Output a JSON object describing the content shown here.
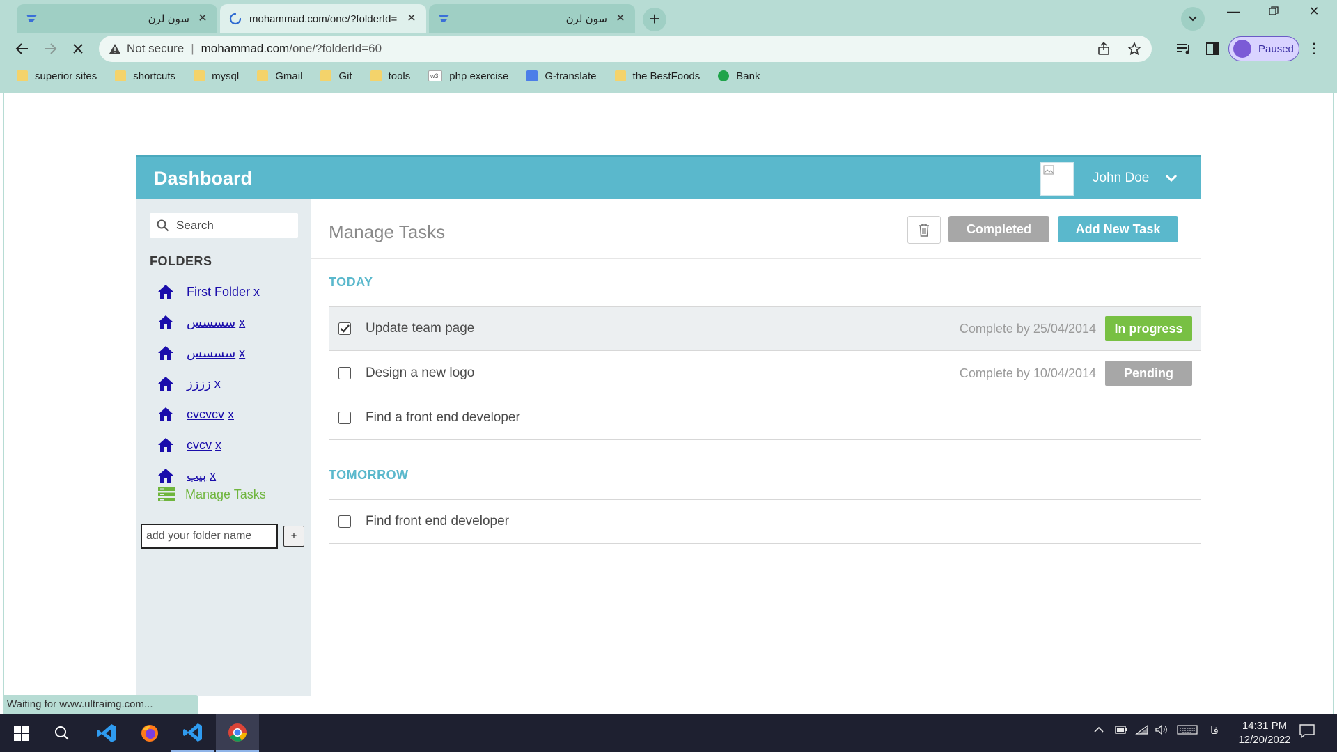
{
  "browser": {
    "tabs": [
      {
        "title": "سون لرن",
        "active": false
      },
      {
        "title": "mohammad.com/one/?folderId=",
        "active": true
      },
      {
        "title": "سون لرن",
        "active": false
      }
    ],
    "address": {
      "security": "Not secure",
      "host": "mohammad.com",
      "path": "/one/?folderId=60"
    },
    "profile_status": "Paused",
    "bookmarks": [
      {
        "label": "superior sites",
        "icon": "folder-icon"
      },
      {
        "label": "shortcuts",
        "icon": "folder-icon"
      },
      {
        "label": "mysql",
        "icon": "folder-icon"
      },
      {
        "label": "Gmail",
        "icon": "folder-icon"
      },
      {
        "label": "Git",
        "icon": "folder-icon"
      },
      {
        "label": "tools",
        "icon": "folder-icon"
      },
      {
        "label": "php exercise",
        "icon": "w3-icon"
      },
      {
        "label": "G-translate",
        "icon": "translate-icon"
      },
      {
        "label": "the BestFoods",
        "icon": "folder-icon"
      },
      {
        "label": "Bank",
        "icon": "check-icon"
      }
    ],
    "w3_favicon_text": "w3r",
    "status_text": "Waiting for www.ultraimg.com..."
  },
  "app": {
    "title": "Dashboard",
    "user_name": "John Doe",
    "search_placeholder": "Search",
    "folders_heading": "FOLDERS",
    "folders": [
      {
        "name": "First Folder",
        "delete": "x"
      },
      {
        "name": "سسسس",
        "delete": "x"
      },
      {
        "name": "سسسس",
        "delete": "x"
      },
      {
        "name": "زززز",
        "delete": "x"
      },
      {
        "name": "cvcvcv",
        "delete": "x"
      },
      {
        "name": "cvcv",
        "delete": "x"
      },
      {
        "name": "بیب",
        "delete": "x"
      }
    ],
    "manage_tasks_link": "Manage Tasks",
    "add_folder_placeholder": "add your folder name",
    "add_folder_button": "+",
    "main_title": "Manage Tasks",
    "completed_button": "Completed",
    "add_task_button": "Add New Task",
    "sections": [
      {
        "label": "TODAY",
        "tasks": [
          {
            "name": "Update team page",
            "checked": true,
            "due": "Complete by 25/04/2014",
            "status": "In progress",
            "status_color": "#78c043"
          },
          {
            "name": "Design a new logo",
            "checked": false,
            "due": "Complete by 10/04/2014",
            "status": "Pending",
            "status_color": "#a7a7a7"
          },
          {
            "name": "Find a front end developer",
            "checked": false,
            "due": "",
            "status": "",
            "status_color": ""
          }
        ]
      },
      {
        "label": "TOMORROW",
        "tasks": [
          {
            "name": "Find front end developer",
            "checked": false,
            "due": "",
            "status": "",
            "status_color": ""
          }
        ]
      }
    ],
    "colors": {
      "header": "#5ab8cc",
      "sidebar": "#e5ecef",
      "link": "#1a0dab",
      "folder_icon": "#1a0dab",
      "manage": "#6fb53d"
    }
  },
  "taskbar": {
    "apps": [
      "start-icon",
      "search-icon",
      "vscode-icon",
      "firefox-icon",
      "vscode-icon",
      "chrome-icon"
    ],
    "lang": "فا",
    "time": "14:31 PM",
    "date": "12/20/2022"
  }
}
